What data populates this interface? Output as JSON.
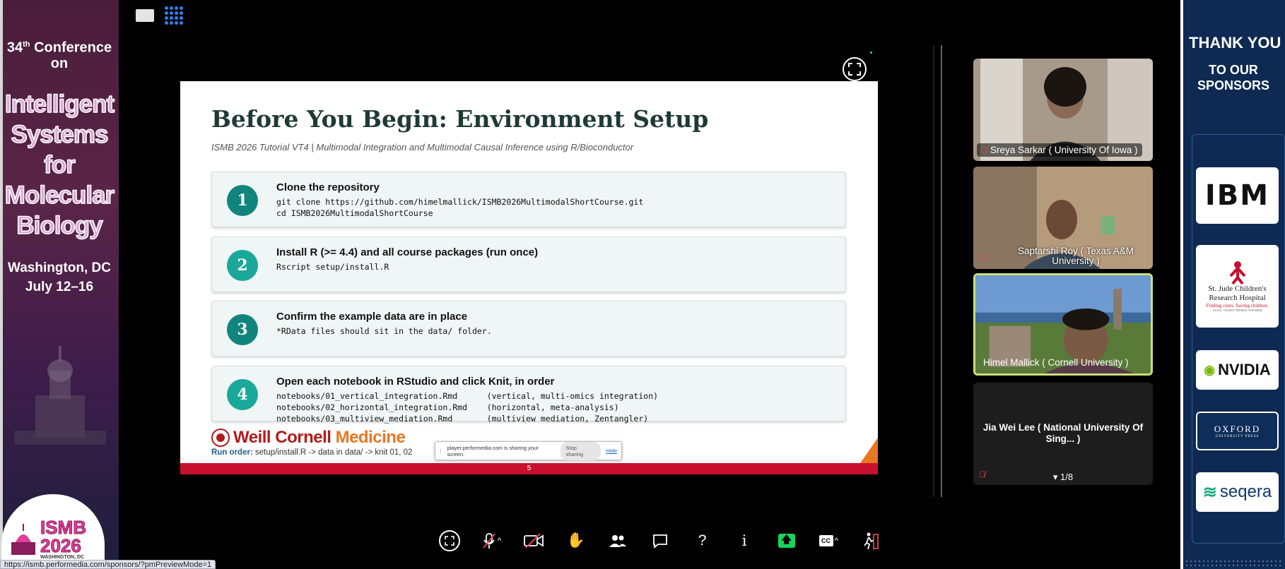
{
  "left_banner": {
    "conf_number": "34",
    "conf_suffix": "th",
    "conf_word": "Conference",
    "conf_on": "on",
    "title_lines": [
      "Intelligent",
      "Systems",
      "for",
      "Molecular",
      "Biology"
    ],
    "location": "Washington, DC",
    "dates": "July 12–16",
    "logo_line1": "ISMB",
    "logo_line2": "2026",
    "logo_line3": "WASHINGTON, DC"
  },
  "status_url": "https://ismb.performedia.com/sponsors/?pmPreviewMode=1",
  "slide": {
    "title": "Before You Begin: Environment Setup",
    "subtitle": "ISMB 2026 Tutorial VT4  |  Multimodal Integration and Multimodal Causal Inference using R/Bioconductor",
    "steps": [
      {
        "num": "1",
        "head": "Clone the repository",
        "code": "git clone https://github.com/himelmallick/ISMB2026MultimodalShortCourse.git\ncd ISMB2026MultimodalShortCourse"
      },
      {
        "num": "2",
        "head": "Install R (>= 4.4) and all course packages  (run once)",
        "code": "Rscript setup/install.R"
      },
      {
        "num": "3",
        "head": "Confirm the example data are in place",
        "code": "*RData files should sit in the data/ folder."
      },
      {
        "num": "4",
        "head": "Open each notebook in RStudio and click Knit, in order",
        "code": "notebooks/01_vertical_integration.Rmd      (vertical, multi-omics integration)\nnotebooks/02_horizontal_integration.Rmd    (horizontal, meta-analysis)\nnotebooks/03_multiview_mediation.Rmd       (multiview mediation, Zentangler)"
      }
    ],
    "brand_a": "Weill Cornell",
    "brand_b": "Medicine",
    "run_order_label": "Run order:",
    "run_order_text": "setup/install.R  ->  data in data/  ->  knit 01, 02",
    "page_number": "5"
  },
  "share_bar": {
    "message": "player.performedia.com is sharing your screen.",
    "stop_label": "Stop sharing",
    "hide_label": "Hide"
  },
  "participants": [
    {
      "name": "Sreya Sarkar ( University Of Iowa )",
      "muted": true
    },
    {
      "name": "Saptarshi Roy ( Texas A&M University )",
      "muted": true
    },
    {
      "name": "Himel Mallick ( Cornell University )",
      "muted": false,
      "active": true
    },
    {
      "name": "Jia Wei Lee ( National University Of Sing... )",
      "muted": true
    }
  ],
  "pager": "1/8",
  "toolbar": [
    {
      "name": "screen-view-button",
      "icon": "screen-view-icon"
    },
    {
      "name": "microphone-button",
      "icon": "microphone-muted-icon"
    },
    {
      "name": "camera-button",
      "icon": "camera-off-icon"
    },
    {
      "name": "raise-hand-button",
      "icon": "hand-icon"
    },
    {
      "name": "participants-button",
      "icon": "people-icon"
    },
    {
      "name": "chat-button",
      "icon": "chat-icon"
    },
    {
      "name": "help-button",
      "icon": "question-icon"
    },
    {
      "name": "info-button",
      "icon": "info-icon"
    },
    {
      "name": "share-screen-button",
      "icon": "share-up-arrow-icon"
    },
    {
      "name": "captions-button",
      "icon": "cc-icon"
    },
    {
      "name": "leave-button",
      "icon": "leave-icon"
    }
  ],
  "right_banner": {
    "thanks": "THANK YOU",
    "to_our": "TO OUR",
    "sponsors": "SPONSORS",
    "sponsor_ibm": "IBM",
    "sponsor_stjude_1": "St. Jude Children's",
    "sponsor_stjude_2": "Research Hospital",
    "sponsor_stjude_3": "Finding cures. Saving children.",
    "sponsor_stjude_4": "ALSAC • DANNY THOMAS, FOUNDER",
    "sponsor_nvidia": "NVIDIA",
    "sponsor_oxford_1": "OXFORD",
    "sponsor_oxford_2": "UNIVERSITY PRESS",
    "sponsor_seqera": "seqera"
  },
  "colors": {
    "slide_accent": "#11857d",
    "brand_red": "#c8102e",
    "brand_orange": "#e87722",
    "active_speaker_border": "#c8e07a",
    "share_green": "#19d35c"
  }
}
